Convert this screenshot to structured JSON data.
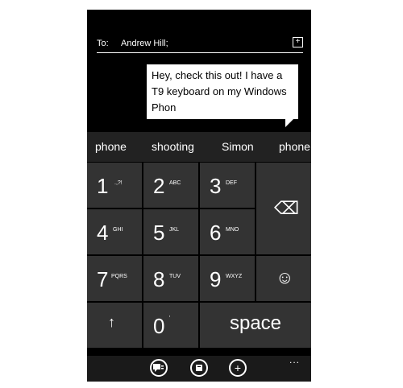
{
  "header": {
    "to_label": "To:",
    "recipient": "Andrew Hill;",
    "add_contact_icon": "add-box-icon"
  },
  "message": {
    "text": "Hey, check this out! I have a T9 keyboard on my Windows Phon"
  },
  "suggestions": [
    "phone",
    "shooting",
    "Simon",
    "phone"
  ],
  "keypad": {
    "k1": {
      "num": "1",
      "letters": ".,?!"
    },
    "k2": {
      "num": "2",
      "letters": "ABC"
    },
    "k3": {
      "num": "3",
      "letters": "DEF"
    },
    "k4": {
      "num": "4",
      "letters": "GHI"
    },
    "k5": {
      "num": "5",
      "letters": "JKL"
    },
    "k6": {
      "num": "6",
      "letters": "MNO"
    },
    "k7": {
      "num": "7",
      "letters": "PQRS"
    },
    "k8": {
      "num": "8",
      "letters": "TUV"
    },
    "k9": {
      "num": "9",
      "letters": "WXYZ"
    },
    "k0": {
      "num": "0",
      "letters": "'"
    },
    "space": "space",
    "shift_icon": "↑",
    "emoji_icon": "☺",
    "backspace_icon": "⌫"
  },
  "appbar": {
    "send_icon": "send-icon",
    "attach_icon": "attach-icon",
    "add_icon": "+",
    "more": "..."
  },
  "colors": {
    "key_bg": "#333333",
    "suggest_bg": "#222222",
    "bubble_bg": "#ffffff"
  }
}
